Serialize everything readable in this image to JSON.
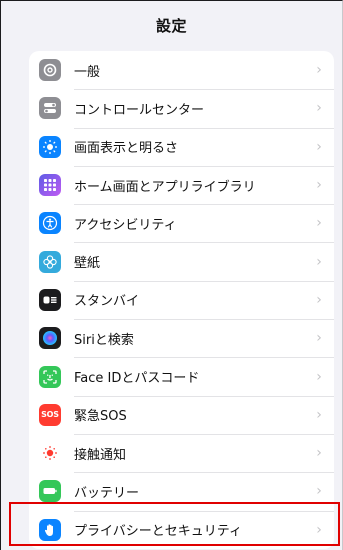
{
  "header": {
    "title": "設定"
  },
  "settings": {
    "items": [
      {
        "label": "一般",
        "icon": "gear-icon",
        "color": "#8e8e93"
      },
      {
        "label": "コントロールセンター",
        "icon": "control-center-icon",
        "color": "#8e8e93"
      },
      {
        "label": "画面表示と明るさ",
        "icon": "sun-icon",
        "color": "#0a84ff"
      },
      {
        "label": "ホーム画面とアプリライブラリ",
        "icon": "home-screen-icon",
        "color": "#5e5ce6"
      },
      {
        "label": "アクセシビリティ",
        "icon": "accessibility-icon",
        "color": "#0a84ff"
      },
      {
        "label": "壁紙",
        "icon": "wallpaper-flower-icon",
        "color": "#34aadc"
      },
      {
        "label": "スタンバイ",
        "icon": "standby-icon",
        "color": "#1c1c1e"
      },
      {
        "label": "Siriと検索",
        "icon": "siri-icon",
        "color": "#1c1c1e"
      },
      {
        "label": "Face IDとパスコード",
        "icon": "face-id-icon",
        "color": "#34c759"
      },
      {
        "label": "緊急SOS",
        "icon": "sos-icon",
        "color": "#ff3b30",
        "icon_text": "SOS"
      },
      {
        "label": "接触通知",
        "icon": "exposure-notification-icon",
        "color": "#ffffff"
      },
      {
        "label": "バッテリー",
        "icon": "battery-icon",
        "color": "#34c759"
      },
      {
        "label": "プライバシーとセキュリティ",
        "icon": "hand-icon",
        "color": "#0a84ff"
      }
    ]
  },
  "highlight": {
    "color": "#e00000",
    "target": "プライバシーとセキュリティ"
  }
}
